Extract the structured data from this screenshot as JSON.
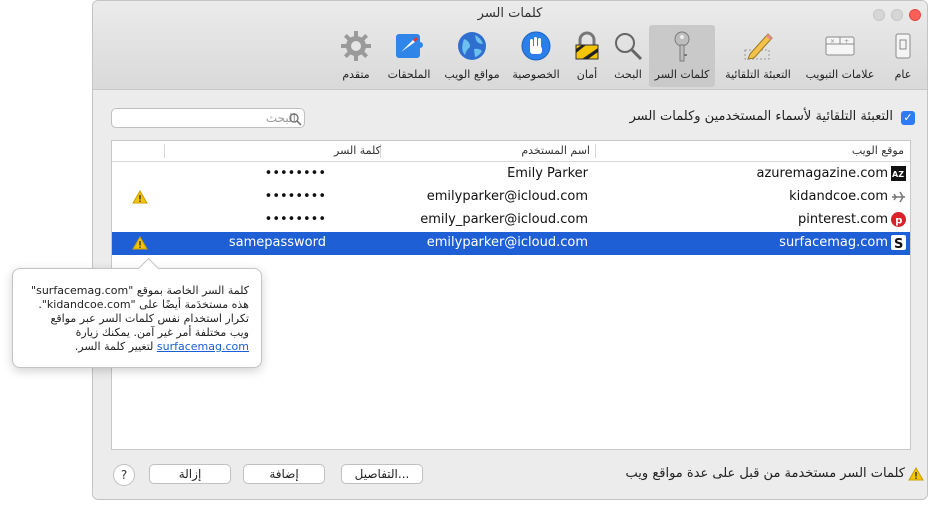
{
  "window": {
    "title": "كلمات السر",
    "traffic_colors": [
      "#d4d4d4",
      "#d4d4d4",
      "#ff5f57"
    ]
  },
  "toolbar": {
    "items": [
      {
        "label": "عام",
        "icon": "general-icon"
      },
      {
        "label": "علامات التبويب",
        "icon": "tabs-icon"
      },
      {
        "label": "التعبئة التلقائية",
        "icon": "pencil-autofill-icon"
      },
      {
        "label": "كلمات السر",
        "icon": "key-icon",
        "selected": true
      },
      {
        "label": "البحث",
        "icon": "magnifier-icon"
      },
      {
        "label": "أمان",
        "icon": "lock-icon"
      },
      {
        "label": "الخصوصية",
        "icon": "hand-icon"
      },
      {
        "label": "مواقع الويب",
        "icon": "globe-icon"
      },
      {
        "label": "الملحقات",
        "icon": "extensions-icon"
      },
      {
        "label": "متقدم",
        "icon": "gear-icon"
      }
    ]
  },
  "search": {
    "placeholder": "البحث"
  },
  "autofill": {
    "checked": true,
    "label": "التعبئة التلقائية لأسماء المستخدمين وكلمات السر"
  },
  "table": {
    "headers": {
      "site": "موقع الويب",
      "user": "اسم المستخدم",
      "pass": "كلمة السر"
    },
    "rows": [
      {
        "site": "azuremagazine.com",
        "user": "Emily Parker",
        "password": "••••••••",
        "warning": false,
        "selected": false,
        "favicon": "az-icon"
      },
      {
        "site": "kidandcoe.com",
        "user": "emilyparker@icloud.com",
        "password": "••••••••",
        "warning": true,
        "selected": false,
        "favicon": "plane-icon"
      },
      {
        "site": "pinterest.com",
        "user": "emily_parker@icloud.com",
        "password": "••••••••",
        "warning": false,
        "selected": false,
        "favicon": "pinterest-icon"
      },
      {
        "site": "surfacemag.com",
        "user": "emilyparker@icloud.com",
        "password": "samepassword",
        "warning": true,
        "selected": true,
        "favicon": "s-icon"
      }
    ]
  },
  "tooltip": {
    "line1": "كلمة السر الخاصة بموقع \"surfacemag.com\"",
    "line2": "هذه مستخدَمة أيضًا على \"kidandcoe.com\".",
    "line3": "تكرار استخدام نفس كلمات السر عبر مواقع",
    "line4": "ويب مختلفة أمر غير آمن. يمكنك زيارة",
    "link": "surfacemag.com",
    "line5_tail": " لتغيير كلمة السر."
  },
  "buttons": {
    "details": "التفاصيل...",
    "add": "إضافة",
    "remove": "إزالة",
    "help": "?"
  },
  "footer_note": "كلمات السر مستخدمة من قبل على عدة مواقع ويب",
  "colors": {
    "accent": "#2f7bf6",
    "selection": "#1f5fd6",
    "warning": "#f5c400"
  }
}
